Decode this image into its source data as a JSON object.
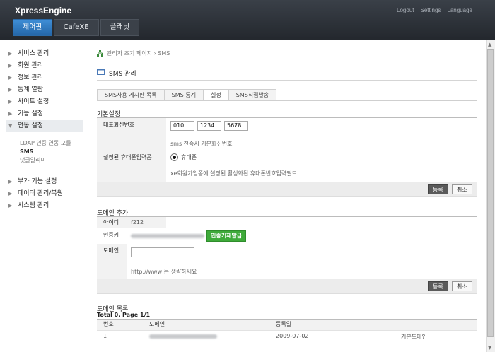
{
  "header": {
    "brand": "XpressEngine",
    "util": [
      "Logout",
      "Settings",
      "Language"
    ],
    "gnb": [
      "제어판",
      "CafeXE",
      "플래닛"
    ]
  },
  "sidebar": {
    "items": [
      "서비스 관리",
      "회원 관리",
      "정보 관리",
      "통계 열람",
      "사이트 설정",
      "기능 설정",
      "연동 설정"
    ],
    "sub_items": [
      "LDAP 인증 연동 모듈",
      "SMS",
      "댓글알리미"
    ],
    "items_after": [
      "부가 기능 설정",
      "데이터 관리/복원",
      "시스템 관리"
    ]
  },
  "breadcrumb": "관리자 초기 페이지 › SMS",
  "module_title": "SMS 관리",
  "tabs": [
    "SMS사용 게시판 목록",
    "SMS 통계",
    "설정",
    "SMS직접발송"
  ],
  "basic": {
    "title": "기본설정",
    "rep_label": "대표회신번호",
    "phone": [
      "010",
      "1234",
      "5678"
    ],
    "rep_desc": "sms 전송시 기본회신번호",
    "phone_field_label": "설정된 휴대폰입력폼",
    "radio_label": "휴대폰",
    "phone_field_desc": "xe회원가입폼에 설정된 활성화된 휴대폰번호입력필드",
    "save": "등록",
    "cancel": "취소"
  },
  "domain_add": {
    "title": "도메인 추가",
    "id_label": "아이디",
    "id_value": "f212",
    "key_label": "인증키",
    "reissue": "인증키재발급",
    "domain_label": "도메인",
    "domain_value": "",
    "domain_desc": "http://www 는 생략하세요",
    "save": "등록",
    "cancel": "취소"
  },
  "domain_list": {
    "title": "도메인 목록",
    "total_prefix": "Total 0, Page ",
    "page": "1/1",
    "headers": [
      "번호",
      "도메인",
      "등록일"
    ],
    "row": {
      "no": "1",
      "date": "2009-07-02",
      "status": "기본도메인"
    }
  }
}
